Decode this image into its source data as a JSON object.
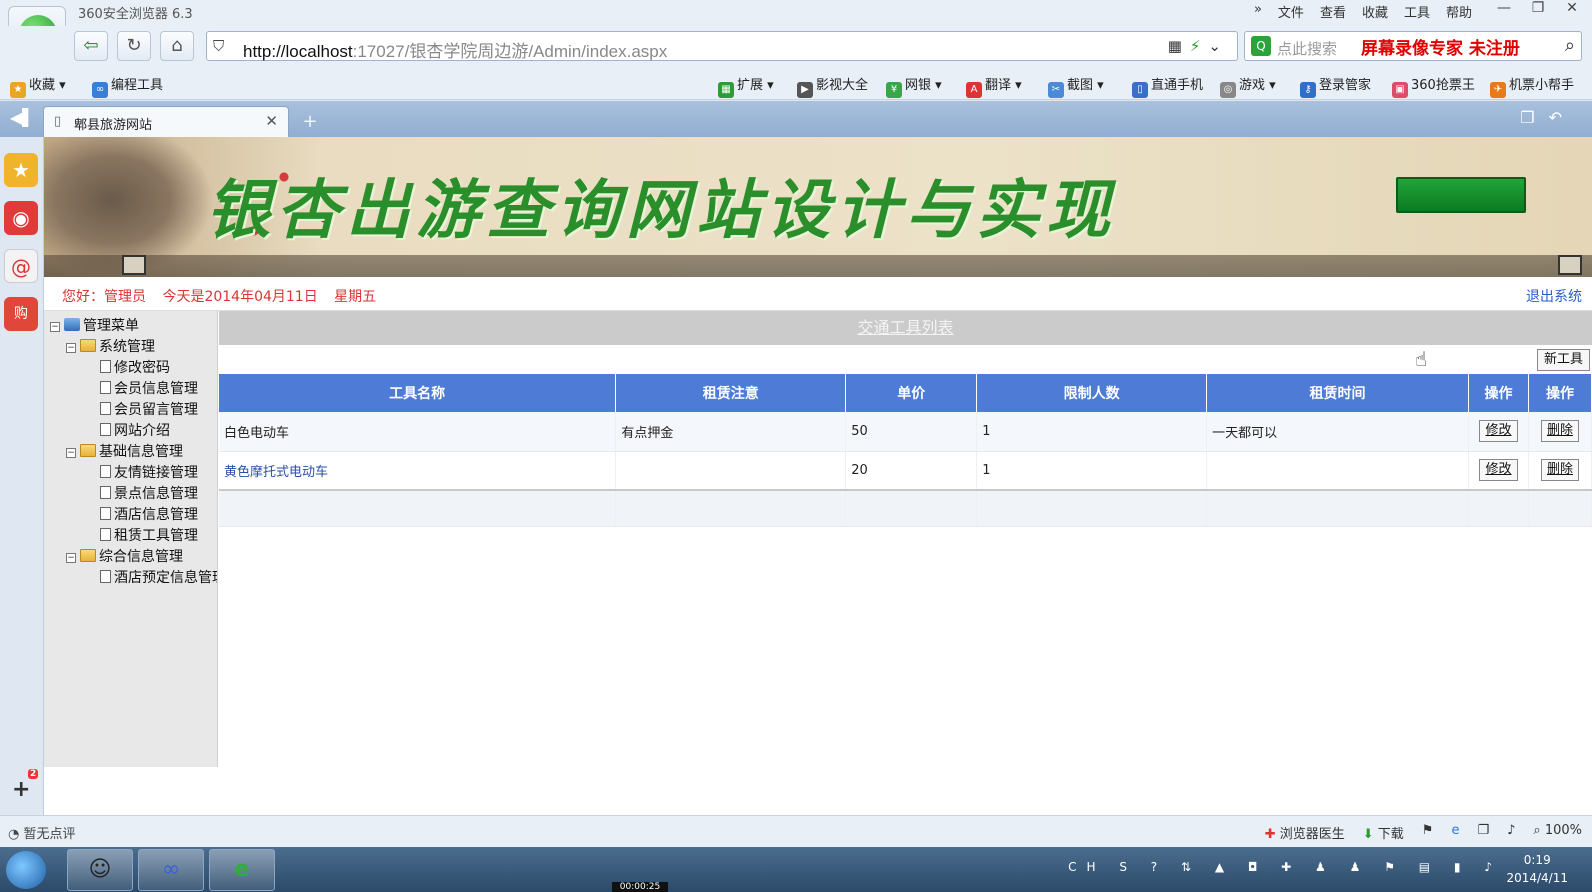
{
  "browser": {
    "app_title": "360安全浏览器 6.3",
    "menu": [
      "文件",
      "查看",
      "收藏",
      "工具",
      "帮助"
    ],
    "more": "»",
    "window_controls": [
      "—",
      "❐",
      "✕"
    ],
    "url_host": "http://localhost",
    "url_path": ":17027/银杏学院周边游/Admin/index.aspx",
    "search_placeholder": "点此搜索",
    "search_promo": "屏幕录像专家  未注册",
    "bookmarks_left": [
      "收藏",
      "编程工具"
    ],
    "bookmarks_right": [
      "扩展",
      "影视大全",
      "网银",
      "翻译",
      "截图",
      "直通手机",
      "游戏",
      "登录管家",
      "360抢票王",
      "机票小帮手"
    ],
    "tab_title": "郫县旅游网站",
    "status_left": "暂无点评",
    "status_items": [
      "浏览器医生",
      "下载",
      "100%"
    ]
  },
  "page": {
    "banner_title": "银杏出游查询网站设计与实现",
    "greeting_user": "您好：管理员",
    "greeting_date": "今天是2014年04月11日",
    "greeting_weekday": "星期五",
    "logout": "退出系统"
  },
  "tree": {
    "root": "管理菜单",
    "groups": [
      {
        "label": "系统管理",
        "items": [
          "修改密码",
          "会员信息管理",
          "会员留言管理",
          "网站介绍"
        ]
      },
      {
        "label": "基础信息管理",
        "items": [
          "友情链接管理",
          "景点信息管理",
          "酒店信息管理",
          "租赁工具管理"
        ]
      },
      {
        "label": "综合信息管理",
        "items": [
          "酒店预定信息管理"
        ]
      }
    ]
  },
  "list": {
    "title": "交通工具列表",
    "new_button": "新工具",
    "columns": [
      "工具名称",
      "租赁注意",
      "单价",
      "限制人数",
      "租赁时间",
      "操作",
      "操作"
    ],
    "rows": [
      {
        "name": "白色电动车",
        "note": "有点押金",
        "price": "50",
        "limit": "1",
        "time": "一天都可以",
        "edit": "修改",
        "delete": "删除"
      },
      {
        "name": "黄色摩托式电动车",
        "note": "",
        "price": "20",
        "limit": "1",
        "time": "",
        "edit": "修改",
        "delete": "删除"
      }
    ]
  },
  "taskbar": {
    "tray_lang": "CH",
    "clock_time": "0:19",
    "clock_date": "2014/4/11",
    "recorder": "00:00:25"
  },
  "colors": {
    "table_header": "#4e7bd6",
    "accent_red": "#d33333",
    "link_blue": "#2a5ec8",
    "banner_green": "#2a8f2a"
  }
}
